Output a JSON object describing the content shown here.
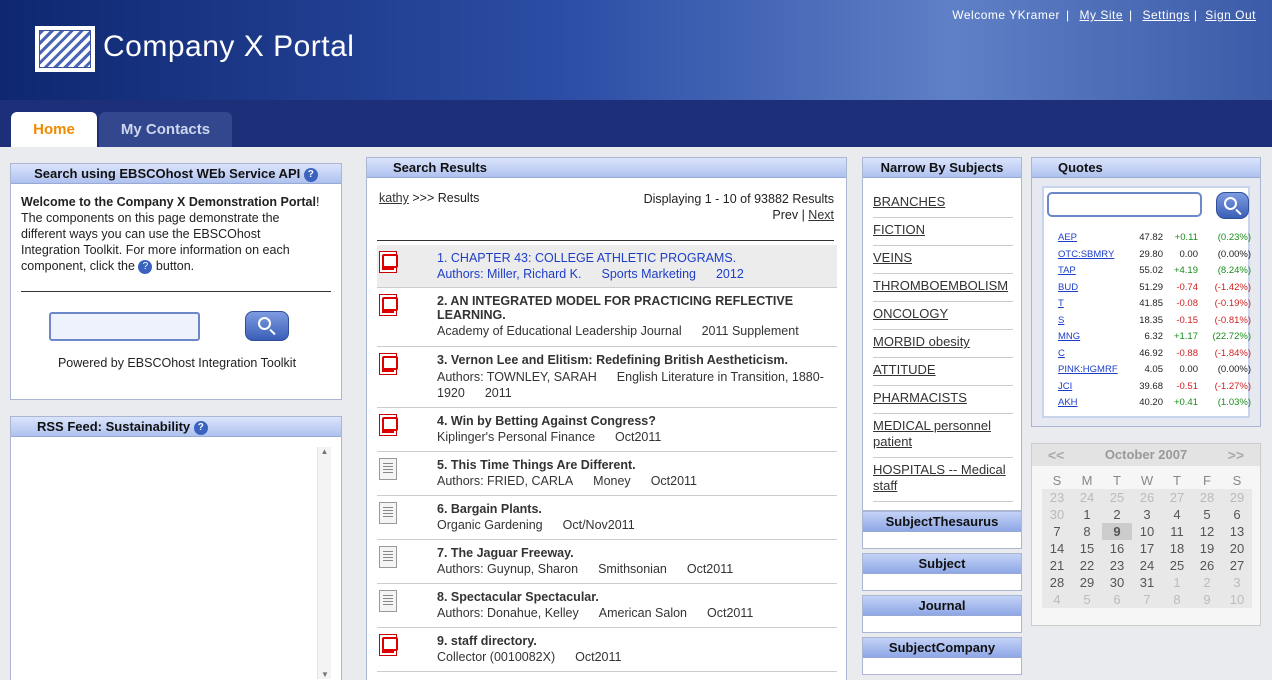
{
  "header": {
    "brand": "Company X Portal",
    "welcome": "Welcome YKramer",
    "my_site": "My Site",
    "settings": "Settings",
    "sign_out": "Sign Out"
  },
  "tabs": {
    "home": "Home",
    "contacts": "My Contacts"
  },
  "search_panel": {
    "title": "Search using EBSCOhost WEb Service API",
    "help_icon": "help-icon",
    "intro_bold": "Welcome to the Company X Demonstration Portal",
    "intro_rest": "! The components on this page demonstrate the different ways you can use the EBSCOhost Integration Toolkit. For more information on each component, click the",
    "intro_end": "button.",
    "input_value": "",
    "powered": "Powered by EBSCOhost Integration Toolkit"
  },
  "rss_panel": {
    "title": "RSS Feed: Sustainability"
  },
  "results": {
    "title": "Search Results",
    "query": "kathy",
    "crumb": ">>> Results",
    "display": "Displaying 1 - 10 of 93882 Results",
    "prev": "Prev",
    "sep": "|",
    "next": "Next",
    "items": [
      {
        "title": "1. CHAPTER 43: COLLEGE ATHLETIC PROGRAMS.",
        "meta": [
          "Authors: Miller, Richard K.",
          "Sports Marketing",
          "2012"
        ],
        "icon": "pdf-icon"
      },
      {
        "title": "2. AN INTEGRATED MODEL FOR PRACTICING REFLECTIVE LEARNING.",
        "meta": [
          "Academy of Educational Leadership Journal",
          "2011 Supplement"
        ],
        "icon": "pdf-icon"
      },
      {
        "title": "3. Vernon Lee and Elitism: Redefining British Aestheticism.",
        "meta": [
          "Authors: TOWNLEY, SARAH",
          "English Literature in Transition, 1880-1920",
          "2011"
        ],
        "icon": "pdf-icon"
      },
      {
        "title": "4. Win by Betting Against Congress?",
        "meta": [
          "Kiplinger's Personal Finance",
          "Oct2011"
        ],
        "icon": "pdf-icon"
      },
      {
        "title": "5. This Time Things Are Different.",
        "meta": [
          "Authors: FRIED, CARLA",
          "Money",
          "Oct2011"
        ],
        "icon": "document-icon"
      },
      {
        "title": "6. Bargain Plants.",
        "meta": [
          "Organic Gardening",
          "Oct/Nov2011"
        ],
        "icon": "document-icon"
      },
      {
        "title": "7. The Jaguar Freeway.",
        "meta": [
          "Authors: Guynup, Sharon",
          "Smithsonian",
          "Oct2011"
        ],
        "icon": "document-icon"
      },
      {
        "title": "8. Spectacular Spectacular.",
        "meta": [
          "Authors: Donahue, Kelley",
          "American Salon",
          "Oct2011"
        ],
        "icon": "document-icon"
      },
      {
        "title": "9. staff directory.",
        "meta": [
          "Collector (0010082X)",
          "Oct2011"
        ],
        "icon": "pdf-icon"
      }
    ]
  },
  "narrow": {
    "title": "Narrow By Subjects",
    "subjects": [
      "BRANCHES",
      "FICTION",
      "VEINS",
      "THROMBOEMBOLISM",
      "ONCOLOGY",
      "MORBID obesity",
      "ATTITUDE",
      "PHARMACISTS",
      "MEDICAL personnel patient",
      "HOSPITALS -- Medical staff"
    ],
    "facets": [
      "SubjectThesaurus",
      "Subject",
      "Journal",
      "SubjectCompany"
    ]
  },
  "quotes": {
    "title": "Quotes",
    "input_value": "",
    "rows": [
      {
        "sym": "AEP",
        "price": "47.82",
        "chg": "+0.11",
        "pct": "(0.23%)",
        "dir": "up"
      },
      {
        "sym": "OTC:SBMRY",
        "price": "29.80",
        "chg": "0.00",
        "pct": "(0.00%)",
        "dir": "flat"
      },
      {
        "sym": "TAP",
        "price": "55.02",
        "chg": "+4.19",
        "pct": "(8.24%)",
        "dir": "up"
      },
      {
        "sym": "BUD",
        "price": "51.29",
        "chg": "-0.74",
        "pct": "(-1.42%)",
        "dir": "dn"
      },
      {
        "sym": "T",
        "price": "41.85",
        "chg": "-0.08",
        "pct": "(-0.19%)",
        "dir": "dn"
      },
      {
        "sym": "S",
        "price": "18.35",
        "chg": "-0.15",
        "pct": "(-0.81%)",
        "dir": "dn"
      },
      {
        "sym": "MNG",
        "price": "6.32",
        "chg": "+1.17",
        "pct": "(22.72%)",
        "dir": "up"
      },
      {
        "sym": "C",
        "price": "46.92",
        "chg": "-0.88",
        "pct": "(-1.84%)",
        "dir": "dn"
      },
      {
        "sym": "PINK:HGMRF",
        "price": "4.05",
        "chg": "0.00",
        "pct": "(0.00%)",
        "dir": "flat"
      },
      {
        "sym": "JCI",
        "price": "39.68",
        "chg": "-0.51",
        "pct": "(-1.27%)",
        "dir": "dn"
      },
      {
        "sym": "AKH",
        "price": "40.20",
        "chg": "+0.41",
        "pct": "(1.03%)",
        "dir": "up"
      }
    ]
  },
  "calendar": {
    "month": "October 2007",
    "prev": "<<",
    "next": ">>",
    "days": [
      "S",
      "M",
      "T",
      "W",
      "T",
      "F",
      "S"
    ],
    "weeks": [
      [
        "23",
        "24",
        "25",
        "26",
        "27",
        "28",
        "29"
      ],
      [
        "30",
        "1",
        "2",
        "3",
        "4",
        "5",
        "6"
      ],
      [
        "7",
        "8",
        "9",
        "10",
        "11",
        "12",
        "13"
      ],
      [
        "14",
        "15",
        "16",
        "17",
        "18",
        "19",
        "20"
      ],
      [
        "21",
        "22",
        "23",
        "24",
        "25",
        "26",
        "27"
      ],
      [
        "28",
        "29",
        "30",
        "31",
        "1",
        "2",
        "3"
      ],
      [
        "4",
        "5",
        "6",
        "7",
        "8",
        "9",
        "10"
      ]
    ],
    "selected": "9"
  }
}
